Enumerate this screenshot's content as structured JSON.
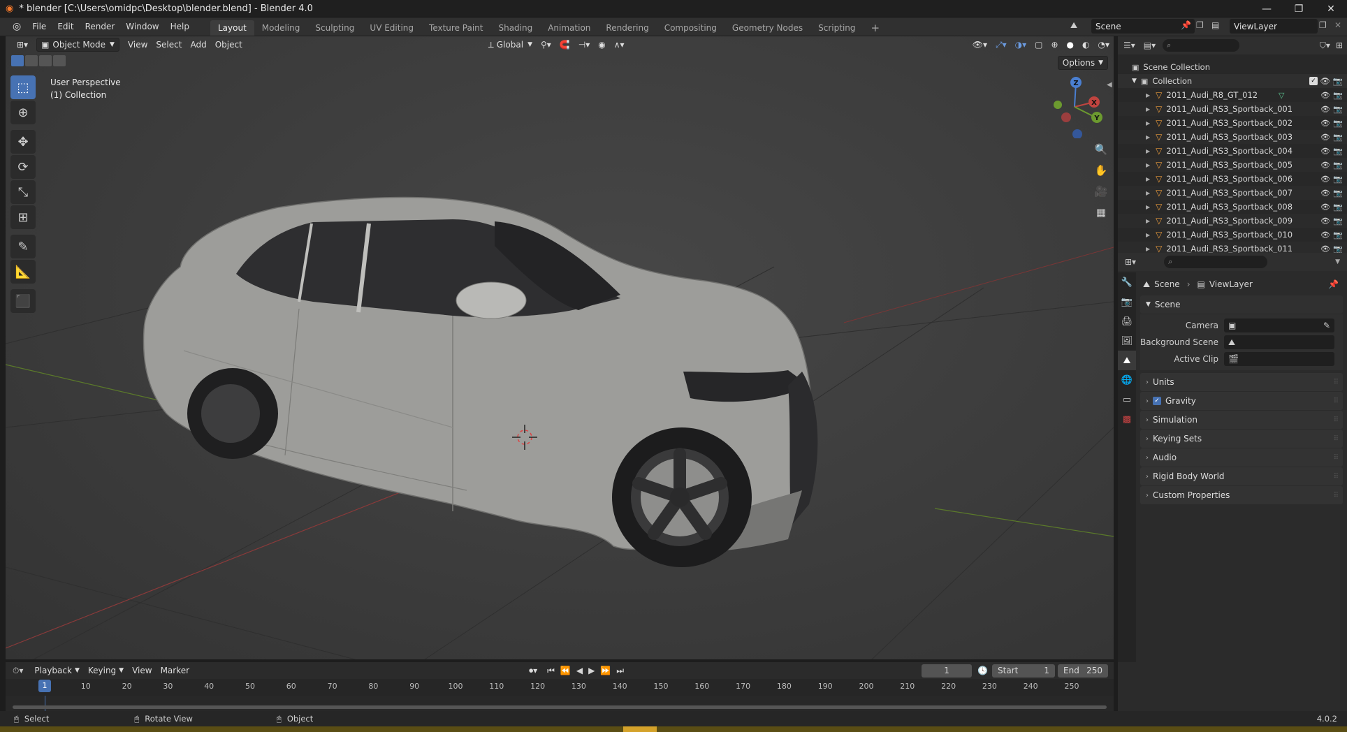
{
  "window": {
    "title": "* blender [C:\\Users\\omidpc\\Desktop\\blender.blend] - Blender 4.0",
    "controls": [
      "—",
      "❐",
      "✕"
    ]
  },
  "topbar": {
    "menus": [
      "File",
      "Edit",
      "Render",
      "Window",
      "Help"
    ],
    "workspaces": [
      "Layout",
      "Modeling",
      "Sculpting",
      "UV Editing",
      "Texture Paint",
      "Shading",
      "Animation",
      "Rendering",
      "Compositing",
      "Geometry Nodes",
      "Scripting"
    ],
    "active_workspace": "Layout",
    "add_tab": "+",
    "scene": "Scene",
    "view_layer": "ViewLayer"
  },
  "viewport": {
    "mode": "Object Mode",
    "menus": [
      "View",
      "Select",
      "Add",
      "Object"
    ],
    "orientation": "Global",
    "options": "Options",
    "info_line1": "User Perspective",
    "info_line2": "(1) Collection",
    "gizmo_labels": {
      "z": "Z",
      "y": "Y",
      "x": "X"
    }
  },
  "outliner": {
    "root": "Scene Collection",
    "collection": "Collection",
    "items": [
      "2011_Audi_R8_GT_012",
      "2011_Audi_RS3_Sportback_001",
      "2011_Audi_RS3_Sportback_002",
      "2011_Audi_RS3_Sportback_003",
      "2011_Audi_RS3_Sportback_004",
      "2011_Audi_RS3_Sportback_005",
      "2011_Audi_RS3_Sportback_006",
      "2011_Audi_RS3_Sportback_007",
      "2011_Audi_RS3_Sportback_008",
      "2011_Audi_RS3_Sportback_009",
      "2011_Audi_RS3_Sportback_010",
      "2011_Audi_RS3_Sportback_011"
    ]
  },
  "properties": {
    "breadcrumb_scene": "Scene",
    "breadcrumb_layer": "ViewLayer",
    "panel_scene": "Scene",
    "fields": [
      {
        "label": "Camera",
        "value": ""
      },
      {
        "label": "Background Scene",
        "value": ""
      },
      {
        "label": "Active Clip",
        "value": ""
      }
    ],
    "panels": [
      "Units",
      "Gravity",
      "Simulation",
      "Keying Sets",
      "Audio",
      "Rigid Body World",
      "Custom Properties"
    ]
  },
  "timeline": {
    "menus": [
      "Playback",
      "Keying",
      "View",
      "Marker"
    ],
    "current_frame": "1",
    "start_label": "Start",
    "start": "1",
    "end_label": "End",
    "end": "250",
    "ticks": [
      "10",
      "20",
      "30",
      "40",
      "50",
      "60",
      "70",
      "80",
      "90",
      "100",
      "110",
      "120",
      "130",
      "140",
      "150",
      "160",
      "170",
      "180",
      "190",
      "200",
      "210",
      "220",
      "230",
      "240",
      "250"
    ],
    "playhead_label": "1"
  },
  "statusbar": {
    "select": "Select",
    "rotate": "Rotate View",
    "object": "Object",
    "version": "4.0.2"
  }
}
